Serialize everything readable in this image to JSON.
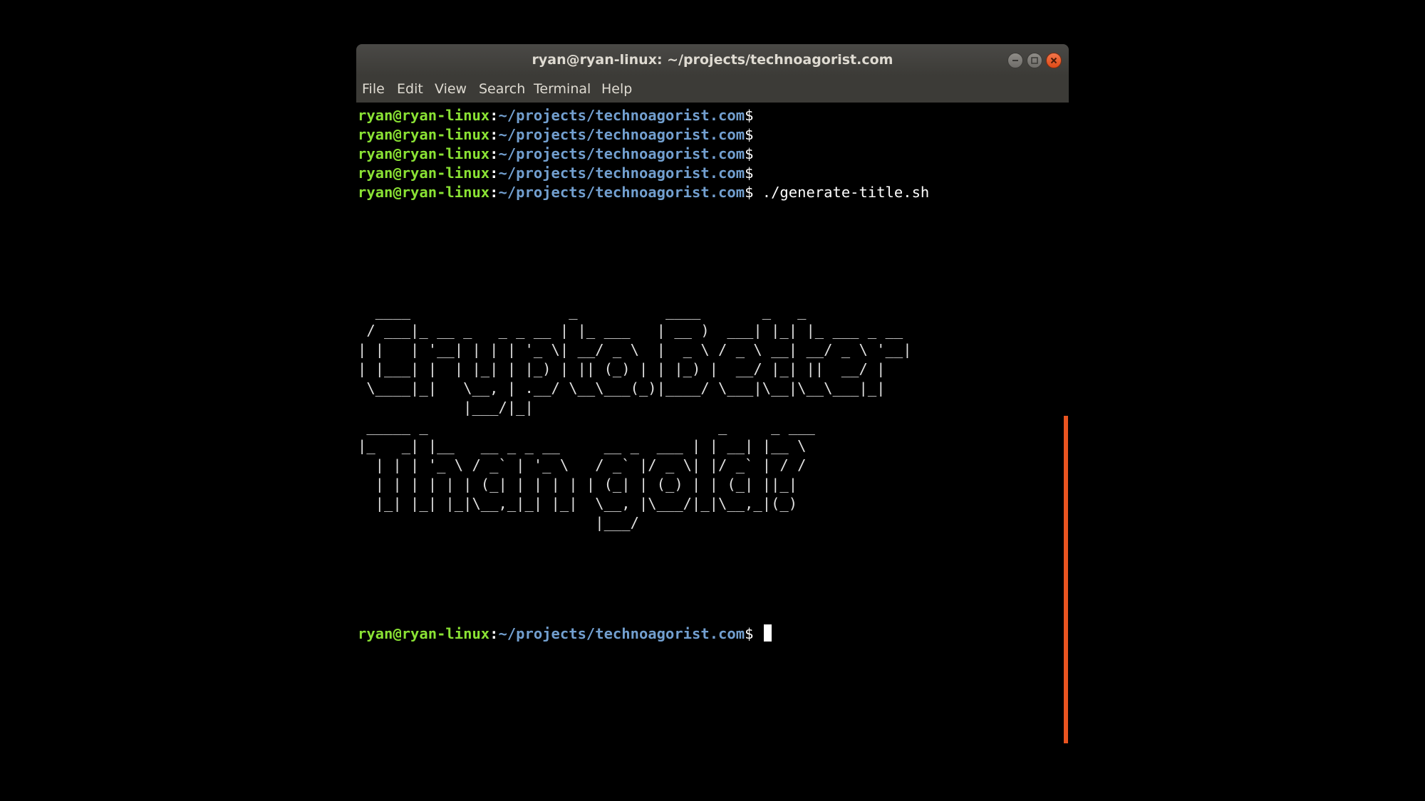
{
  "window": {
    "title": "ryan@ryan-linux: ~/projects/technoagorist.com"
  },
  "menu": {
    "file": "File",
    "edit": "Edit",
    "view": "View",
    "search": "Search",
    "terminal": "Terminal",
    "help": "Help"
  },
  "prompt": {
    "user_host": "ryan@ryan-linux",
    "colon": ":",
    "path": "~/projects/technoagorist.com",
    "symbol": "$"
  },
  "command": " ./generate-title.sh",
  "ascii_art": {
    "line1": "  ____                  _          ____       _   _            \n / ___|_ __ _   _ _ __ | |_ ___   | __ )  ___| |_| |_ ___ _ __ \n| |   | '__| | | | '_ \\| __/ _ \\  |  _ \\ / _ \\ __| __/ _ \\ '__|\n| |___| |  | |_| | |_) | || (_) | | |_) |  __/ |_| ||  __/ |   \n \\____|_|   \\__, | .__/ \\__\\___(_)|____/ \\___|\\__|\\__\\___|_|   \n            |___/|_|                                           ",
    "line2": " _____ _                                 _     _ ___ \n|_   _| |__   __ _ _ __     __ _  ___ | | __| |__ \\\n  | | | '_ \\ / _` | '_ \\   / _` |/ _ \\| |/ _` | / /\n  | | | | | | (_| | | | | | (_| | (_) | | (_| ||_| \n  |_| |_| |_|\\__,_|_| |_|  \\__, |\\___/|_|\\__,_|(_) \n                           |___/                   "
  },
  "colors": {
    "titlebar": "#3c3b37",
    "prompt_user": "#8ae234",
    "prompt_path": "#729fcf",
    "scrollbar": "#e95420",
    "close_button": "#df4a16"
  }
}
